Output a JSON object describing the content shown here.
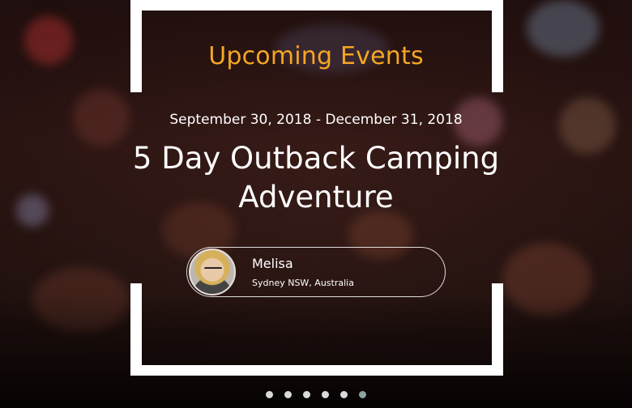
{
  "section": {
    "title": "Upcoming Events"
  },
  "event": {
    "date_range": "September 30, 2018 - December 31, 2018",
    "title": "5 Day Outback Camping Adventure"
  },
  "host": {
    "name": "Melisa",
    "location": "Sydney NSW, Australia"
  },
  "carousel": {
    "slide_count": 6,
    "active_index": 5
  },
  "colors": {
    "accent": "#f5a623",
    "frame": "#ffffff",
    "active_dot": "#8aa3a3"
  }
}
